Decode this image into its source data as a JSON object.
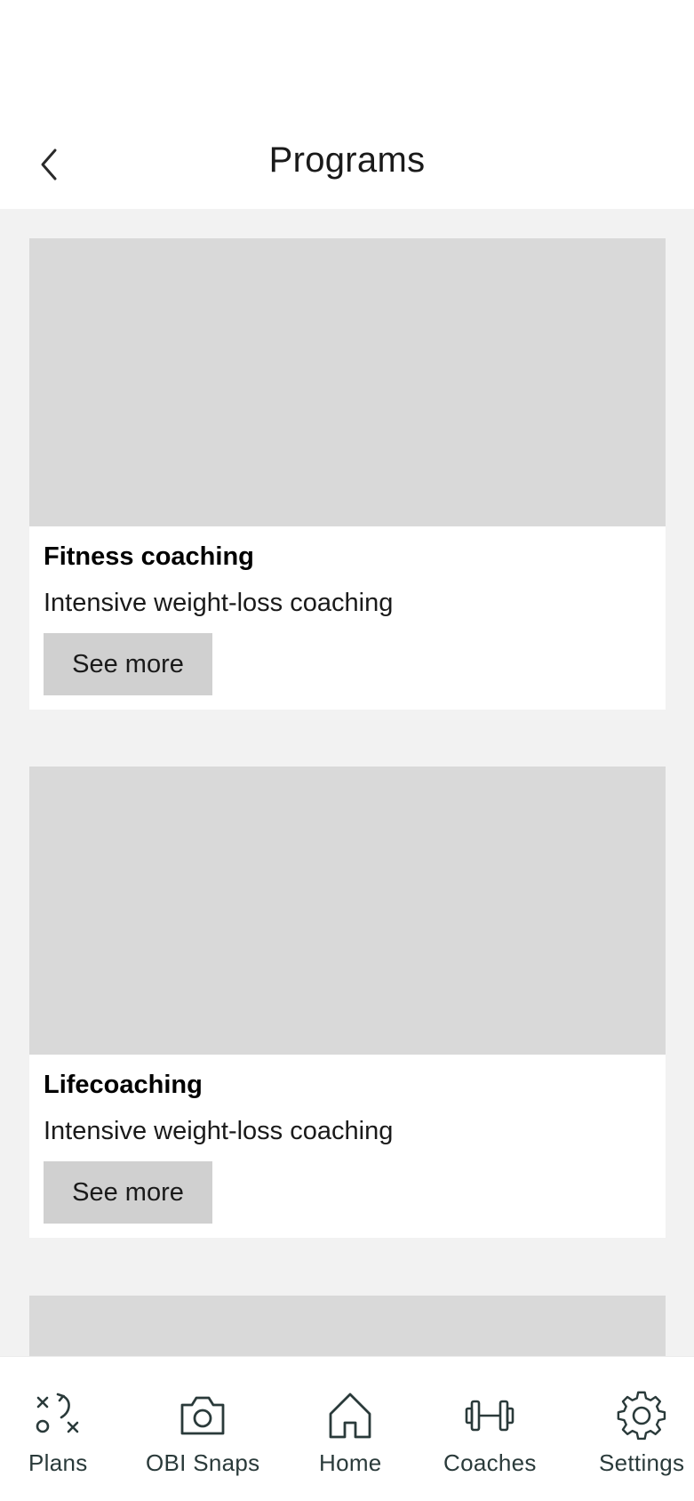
{
  "header": {
    "title": "Programs",
    "back_icon": "chevron-left-icon"
  },
  "programs": [
    {
      "title": "Fitness coaching",
      "description": "Intensive weight-loss coaching",
      "button_label": "See more"
    },
    {
      "title": "Lifecoaching",
      "description": "Intensive weight-loss coaching",
      "button_label": "See more"
    }
  ],
  "bottom_nav": {
    "items": [
      {
        "label": "Plans",
        "icon": "plans-icon"
      },
      {
        "label": "OBI Snaps",
        "icon": "camera-icon"
      },
      {
        "label": "Home",
        "icon": "home-icon"
      },
      {
        "label": "Coaches",
        "icon": "dumbbell-icon"
      },
      {
        "label": "Settings",
        "icon": "gear-icon"
      }
    ]
  },
  "colors": {
    "content_background": "#f2f2f2",
    "image_placeholder": "#d9d9d9",
    "button_background": "#d0d0d0",
    "nav_icon": "#2a3a3a"
  }
}
